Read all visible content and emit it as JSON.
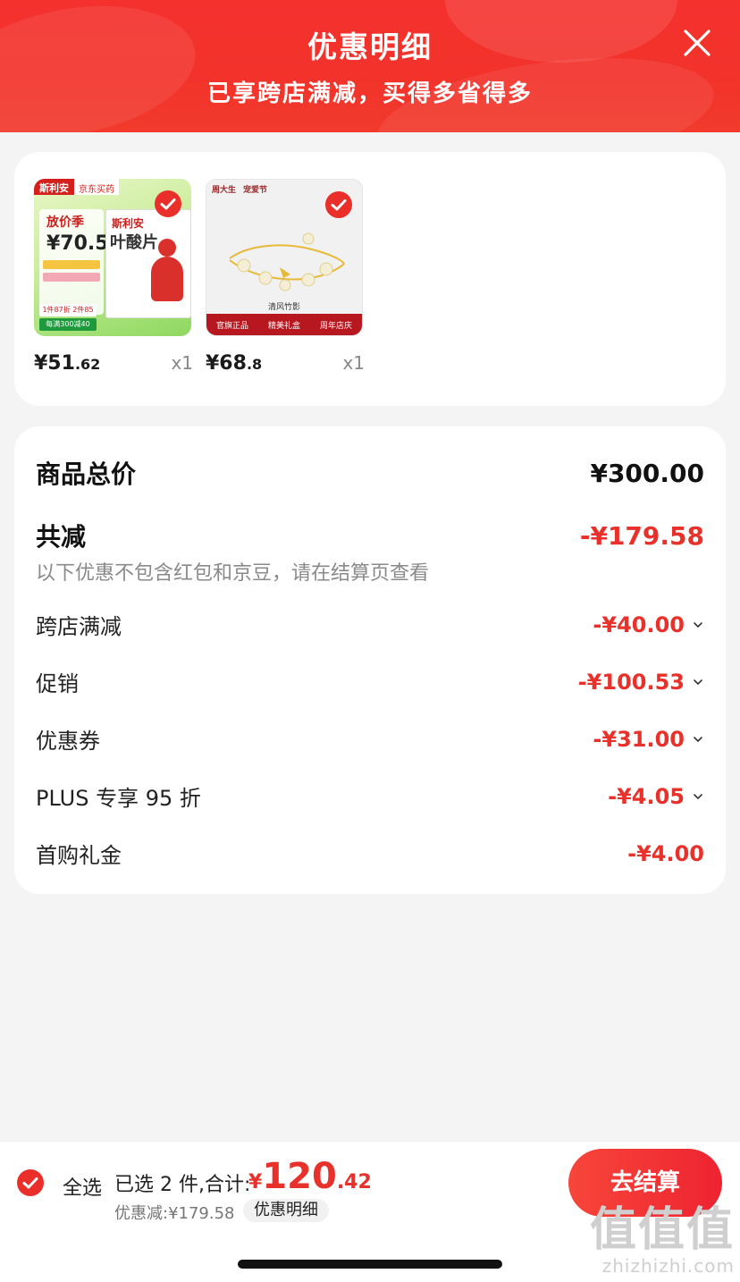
{
  "header": {
    "title": "优惠明细",
    "subtitle": "已享跨店满减，买得多省得多",
    "close_icon": "close-icon"
  },
  "products": [
    {
      "price_int": "¥51",
      "price_dec": ".62",
      "qty": "x1",
      "selected": true,
      "thumb_text": {
        "brand": "斯利安",
        "store": "京东买药",
        "promo_title": "放价季",
        "promo_price": "¥70.5",
        "box_brand": "斯利安",
        "box_name": "叶酸片",
        "strip1": "1件87折 2件85折",
        "strip2": "每满300减40"
      }
    },
    {
      "price_int": "¥68",
      "price_dec": ".8",
      "qty": "x1",
      "selected": true,
      "thumb_text": {
        "brand": "周大生",
        "tag": "宠爱节",
        "caption": "清风竹影",
        "bar": [
          "官旗正品",
          "精美礼盒",
          "周年店庆"
        ]
      }
    }
  ],
  "summary": {
    "total_label": "商品总价",
    "total_value": "¥300.00",
    "reduce_label": "共减",
    "reduce_value": "-¥179.58",
    "note": "以下优惠不包含红包和京豆，请在结算页查看",
    "items": [
      {
        "label": "跨店满减",
        "value": "-¥40.00",
        "expandable": true
      },
      {
        "label": "促销",
        "value": "-¥100.53",
        "expandable": true
      },
      {
        "label": "优惠券",
        "value": "-¥31.00",
        "expandable": true
      },
      {
        "label": "PLUS 专享 95 折",
        "value": "-¥4.05",
        "expandable": true
      },
      {
        "label": "首购礼金",
        "value": "-¥4.00",
        "expandable": false
      }
    ]
  },
  "bottom_bar": {
    "select_all": "全选",
    "selected_text": "已选 2 件,合计:",
    "grand_total_yen": "¥",
    "grand_total_int": "120",
    "grand_total_dec": ".42",
    "discount_line": "优惠减:¥179.58",
    "detail_chip": "优惠明细",
    "checkout": "去结算"
  },
  "watermark": {
    "big": "值值值",
    "small": "zhizhizhi.com"
  },
  "colors": {
    "accent": "#e8312b",
    "header_bg": "#f2322b",
    "page_bg": "#f4f4f4"
  }
}
